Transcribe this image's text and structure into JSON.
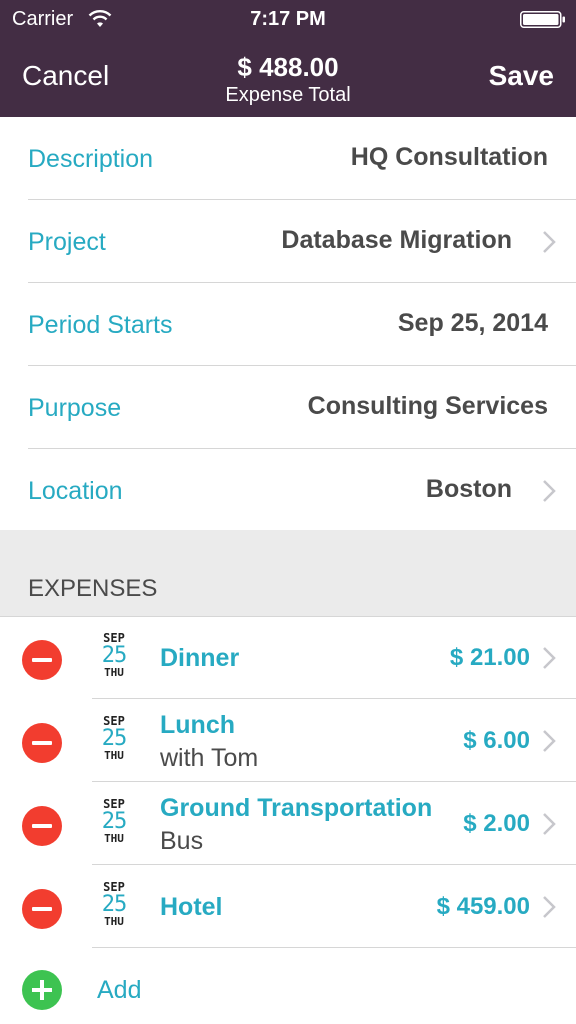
{
  "status_bar": {
    "carrier": "Carrier",
    "time": "7:17 PM"
  },
  "nav": {
    "cancel_label": "Cancel",
    "title": "$ 488.00",
    "subtitle": "Expense Total",
    "save_label": "Save"
  },
  "form": {
    "fields": [
      {
        "label": "Description",
        "value": "HQ Consultation"
      },
      {
        "label": "Project",
        "value": "Database Migration"
      },
      {
        "label": "Period Starts",
        "value": "Sep 25, 2014"
      },
      {
        "label": "Purpose",
        "value": "Consulting Services"
      },
      {
        "label": "Location",
        "value": "Boston"
      }
    ]
  },
  "expenses_section": {
    "title": "EXPENSES",
    "items": [
      {
        "month": "SEP",
        "day": "25",
        "weekday": "THU",
        "name": "Dinner",
        "note": "",
        "amount": "$ 21.00"
      },
      {
        "month": "SEP",
        "day": "25",
        "weekday": "THU",
        "name": "Lunch",
        "note": "with Tom",
        "amount": "$ 6.00"
      },
      {
        "month": "SEP",
        "day": "25",
        "weekday": "THU",
        "name": "Ground Transportation",
        "note": "Bus",
        "amount": "$ 2.00"
      },
      {
        "month": "SEP",
        "day": "25",
        "weekday": "THU",
        "name": "Hotel",
        "note": "",
        "amount": "$ 459.00"
      }
    ],
    "add_label": "Add"
  },
  "colors": {
    "header_bg": "#432d44",
    "accent": "#27aac2",
    "delete": "#f23d2f",
    "add": "#3dc351"
  },
  "icons": [
    "wifi-icon",
    "battery-icon",
    "chevron-right-icon",
    "delete-minus-icon",
    "add-plus-icon",
    "calendar-date-icon"
  ]
}
